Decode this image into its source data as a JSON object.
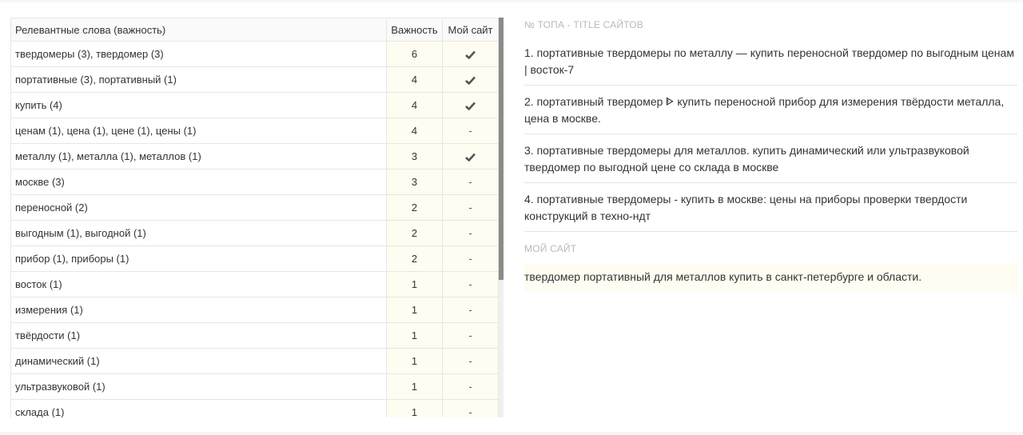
{
  "table": {
    "header_keyword": "Релевантные слова (важность)",
    "header_importance": "Важность",
    "header_mysite": "Мой сайт",
    "rows": [
      {
        "keyword": "твердомеры (3), твердомер (3)",
        "importance": "6",
        "mine": "check-icon"
      },
      {
        "keyword": "портативные (3), портативный (1)",
        "importance": "4",
        "mine": "check-icon"
      },
      {
        "keyword": "купить (4)",
        "importance": "4",
        "mine": "check-icon"
      },
      {
        "keyword": "ценам (1), цена (1), цене (1), цены (1)",
        "importance": "4",
        "mine": "-"
      },
      {
        "keyword": "металлу (1), металла (1), металлов (1)",
        "importance": "3",
        "mine": "check-icon"
      },
      {
        "keyword": "москве (3)",
        "importance": "3",
        "mine": "-"
      },
      {
        "keyword": "переносной (2)",
        "importance": "2",
        "mine": "-"
      },
      {
        "keyword": "выгодным (1), выгодной (1)",
        "importance": "2",
        "mine": "-"
      },
      {
        "keyword": "прибор (1), приборы (1)",
        "importance": "2",
        "mine": "-"
      },
      {
        "keyword": "восток (1)",
        "importance": "1",
        "mine": "-"
      },
      {
        "keyword": "измерения (1)",
        "importance": "1",
        "mine": "-"
      },
      {
        "keyword": "твёрдости (1)",
        "importance": "1",
        "mine": "-"
      },
      {
        "keyword": "динамический (1)",
        "importance": "1",
        "mine": "-"
      },
      {
        "keyword": "ультразвуковой (1)",
        "importance": "1",
        "mine": "-"
      },
      {
        "keyword": "склада (1)",
        "importance": "1",
        "mine": "-"
      }
    ]
  },
  "right": {
    "top_titles_heading": "№ ТОПА - TITLE САЙТОВ",
    "titles": [
      "1. портативные твердомеры по металлу — купить переносной твердомер по выгодным ценам | восток-7",
      "2. портативный твердомер ᐈ купить переносной прибор для измерения твёрдости металла, цена в москве.",
      "3. портативные твердомеры для металлов. купить динамический или ультразвуковой твердомер по выгодной цене со склада в москве",
      "4. портативные твердомеры - купить в москве: цены на приборы проверки твердости конструкций в техно-ндт"
    ],
    "my_site_heading": "МОЙ САЙТ",
    "my_site_title": "твердомер портативный для металлов купить в санкт-петербурге и области."
  },
  "colors": {
    "highlight": "#fffdf1",
    "border": "#e6e6e6",
    "muted": "#b9b9b9"
  }
}
